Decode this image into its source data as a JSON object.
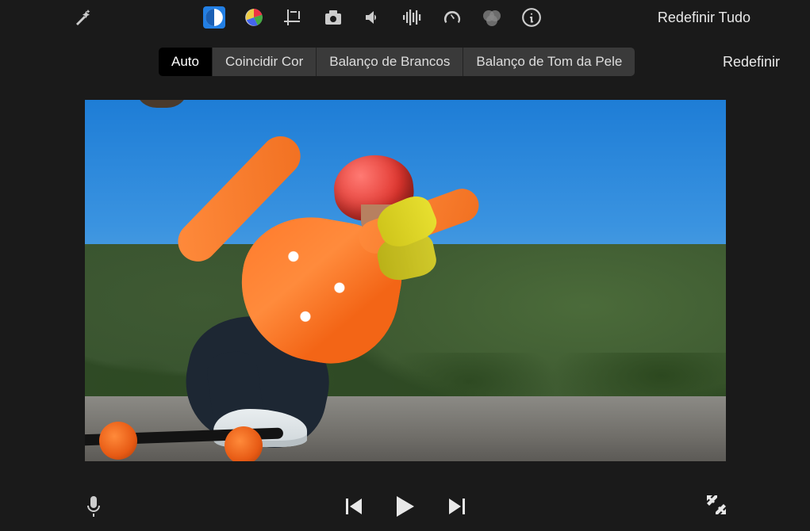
{
  "toolbar": {
    "reset_all": "Redefinir Tudo",
    "icons": {
      "magic_wand": "magic-wand-icon",
      "color_balance": "color-balance-icon",
      "color_correction": "color-correction-icon",
      "crop": "crop-icon",
      "stabilize": "stabilize-icon",
      "volume": "volume-icon",
      "noise": "noise-reduction-icon",
      "speed": "speed-icon",
      "filters": "filters-icon",
      "info": "info-icon"
    }
  },
  "segmented": {
    "items": [
      {
        "label": "Auto",
        "active": true
      },
      {
        "label": "Coincidir Cor",
        "active": false
      },
      {
        "label": "Balanço de Brancos",
        "active": false
      },
      {
        "label": "Balanço de Tom da Pele",
        "active": false
      }
    ],
    "redefine": "Redefinir"
  },
  "transport": {
    "prev": "previous-edit-icon",
    "play": "play-icon",
    "next": "next-edit-icon"
  },
  "bottom": {
    "mic": "microphone-icon",
    "expand": "fullscreen-icon"
  }
}
